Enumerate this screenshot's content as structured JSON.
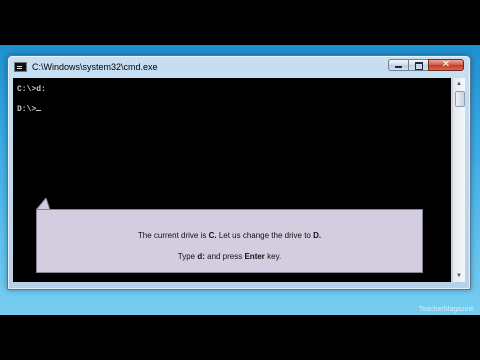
{
  "window": {
    "title": "C:\\Windows\\system32\\cmd.exe"
  },
  "console": {
    "lines": [
      "C:\\>d:",
      "",
      "D:\\>"
    ]
  },
  "callout": {
    "line1_pre": "The current drive is ",
    "line1_drive_c": "C.",
    "line1_mid": " Let us change the drive to ",
    "line1_drive_d": "D.",
    "line2_pre": "Type ",
    "line2_cmd": "d:",
    "line2_mid": " and press ",
    "line2_key": "Enter",
    "line2_post": " key."
  },
  "watermark": "TeacherMagazine",
  "colors": {
    "console_bg": "#000000",
    "console_text": "#c8c8c8",
    "callout_bg": "#d4cde0",
    "close_button": "#c23a23"
  },
  "icons": {
    "app": "cmd-icon",
    "minimize": "minimize-icon",
    "maximize": "maximize-icon",
    "close": "close-icon"
  }
}
